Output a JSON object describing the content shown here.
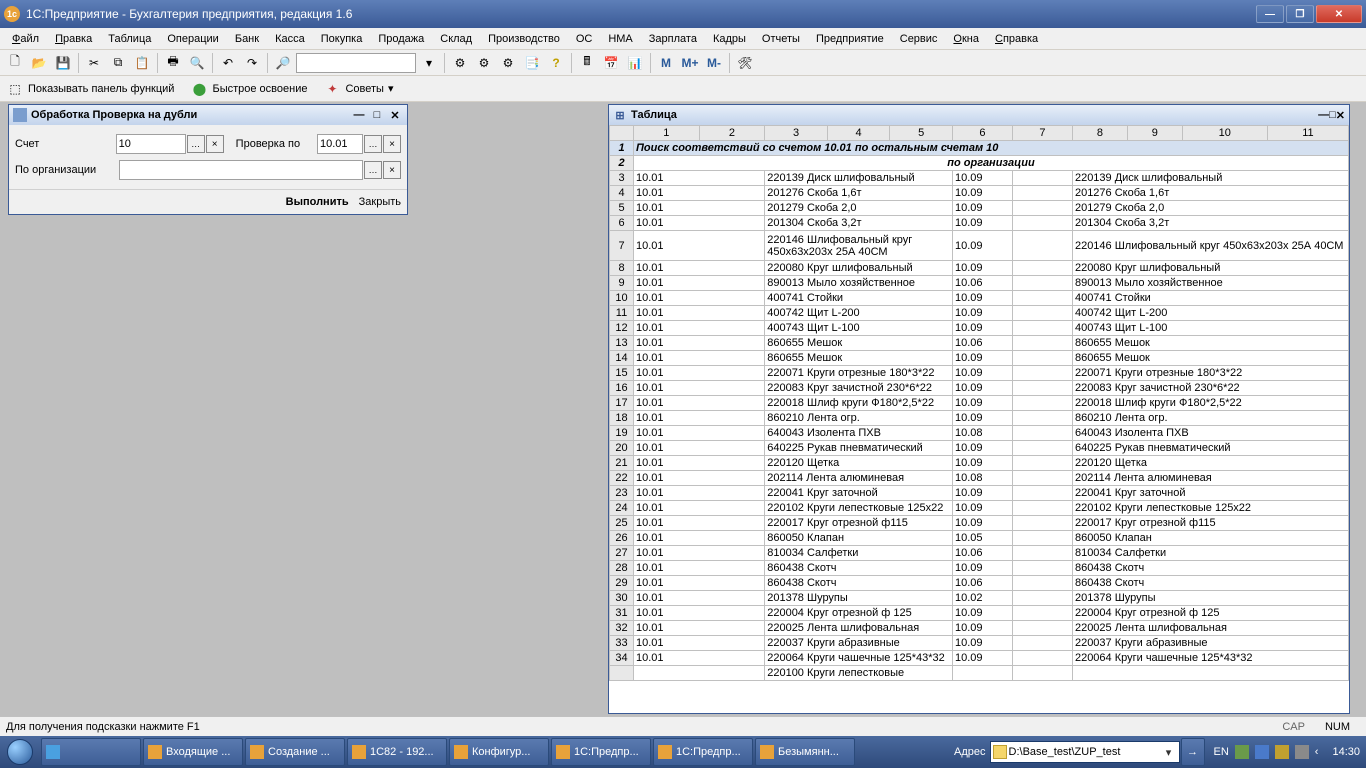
{
  "titlebar": {
    "text": "1С:Предприятие - Бухгалтерия предприятия, редакция 1.6"
  },
  "menu": [
    "Файл",
    "Правка",
    "Таблица",
    "Операции",
    "Банк",
    "Касса",
    "Покупка",
    "Продажа",
    "Склад",
    "Производство",
    "ОС",
    "НМА",
    "Зарплата",
    "Кадры",
    "Отчеты",
    "Предприятие",
    "Сервис",
    "Окна",
    "Справка"
  ],
  "menu_keys": [
    "Ф",
    "П",
    "",
    "",
    "",
    "",
    "",
    "",
    "",
    "",
    "",
    "",
    "",
    "",
    "",
    "",
    "",
    "О",
    "С"
  ],
  "toolbar2": {
    "m": "М",
    "mp": "М+",
    "mm": "М-"
  },
  "toolbar3": {
    "panel": "Показывать панель функций",
    "quick": "Быстрое освоение",
    "tips": "Советы"
  },
  "dlg": {
    "title": "Обработка  Проверка на дубли",
    "lbl_account": "Счет",
    "val_account": "10",
    "lbl_check": "Проверка по",
    "val_check": "10.01",
    "lbl_org": "По организации",
    "val_org": "",
    "run": "Выполнить",
    "close": "Закрыть"
  },
  "sheet": {
    "title": "Таблица",
    "cols": [
      "1",
      "2",
      "3",
      "4",
      "5",
      "6",
      "7",
      "8",
      "9",
      "10",
      "11"
    ],
    "row1": "Поиск соответствий со счетом 10.01 по остальным счетам 10",
    "row2": "по организации",
    "rows": [
      {
        "n": "3",
        "a": "10.01",
        "d1": "220139 Диск шлифовальный",
        "a2": "10.09",
        "d2": "220139 Диск шлифовальный"
      },
      {
        "n": "4",
        "a": "10.01",
        "d1": "201276 Скоба 1,6т",
        "a2": "10.09",
        "d2": "201276 Скоба 1,6т"
      },
      {
        "n": "5",
        "a": "10.01",
        "d1": "201279 Скоба 2,0",
        "a2": "10.09",
        "d2": "201279 Скоба 2,0"
      },
      {
        "n": "6",
        "a": "10.01",
        "d1": "201304 Скоба 3,2т",
        "a2": "10.09",
        "d2": "201304 Скоба 3,2т"
      },
      {
        "n": "7",
        "a": "10.01",
        "d1": "220146 Шлифовальный круг 450х63х203х 25А 40СМ",
        "a2": "10.09",
        "d2": "220146 Шлифовальный круг 450х63х203х 25А 40СМ"
      },
      {
        "n": "8",
        "a": "10.01",
        "d1": "220080 Круг шлифовальный",
        "a2": "10.09",
        "d2": "220080 Круг шлифовальный"
      },
      {
        "n": "9",
        "a": "10.01",
        "d1": "890013 Мыло хозяйственное",
        "a2": "10.06",
        "d2": "890013 Мыло хозяйственное"
      },
      {
        "n": "10",
        "a": "10.01",
        "d1": "400741 Стойки",
        "a2": "10.09",
        "d2": "400741 Стойки"
      },
      {
        "n": "11",
        "a": "10.01",
        "d1": "400742 Щит L-200",
        "a2": "10.09",
        "d2": "400742 Щит L-200"
      },
      {
        "n": "12",
        "a": "10.01",
        "d1": "400743 Щит L-100",
        "a2": "10.09",
        "d2": "400743 Щит L-100"
      },
      {
        "n": "13",
        "a": "10.01",
        "d1": "860655 Мешок",
        "a2": "10.06",
        "d2": "860655 Мешок"
      },
      {
        "n": "14",
        "a": "10.01",
        "d1": "860655 Мешок",
        "a2": "10.09",
        "d2": "860655 Мешок"
      },
      {
        "n": "15",
        "a": "10.01",
        "d1": "220071 Круги отрезные 180*3*22",
        "a2": "10.09",
        "d2": "220071 Круги отрезные 180*3*22"
      },
      {
        "n": "16",
        "a": "10.01",
        "d1": "220083 Круг зачистной 230*6*22",
        "a2": "10.09",
        "d2": "220083 Круг зачистной 230*6*22"
      },
      {
        "n": "17",
        "a": "10.01",
        "d1": "220018 Шлиф круги Ф180*2,5*22",
        "a2": "10.09",
        "d2": "220018 Шлиф круги Ф180*2,5*22"
      },
      {
        "n": "18",
        "a": "10.01",
        "d1": "860210 Лента огр.",
        "a2": "10.09",
        "d2": "860210 Лента огр."
      },
      {
        "n": "19",
        "a": "10.01",
        "d1": "640043 Изолента  ПХВ",
        "a2": "10.08",
        "d2": "640043 Изолента  ПХВ"
      },
      {
        "n": "20",
        "a": "10.01",
        "d1": "640225 Рукав пневматический",
        "a2": "10.09",
        "d2": "640225 Рукав пневматический"
      },
      {
        "n": "21",
        "a": "10.01",
        "d1": "220120 Щетка",
        "a2": "10.09",
        "d2": "220120 Щетка"
      },
      {
        "n": "22",
        "a": "10.01",
        "d1": "202114 Лента алюминевая",
        "a2": "10.08",
        "d2": "202114 Лента алюминевая"
      },
      {
        "n": "23",
        "a": "10.01",
        "d1": "220041 Круг заточной",
        "a2": "10.09",
        "d2": "220041 Круг заточной"
      },
      {
        "n": "24",
        "a": "10.01",
        "d1": "220102 Круги лепестковые 125х22",
        "a2": "10.09",
        "d2": "220102 Круги лепестковые 125х22"
      },
      {
        "n": "25",
        "a": "10.01",
        "d1": "220017 Круг отрезной ф115",
        "a2": "10.09",
        "d2": "220017 Круг отрезной ф115"
      },
      {
        "n": "26",
        "a": "10.01",
        "d1": "860050 Клапан",
        "a2": "10.05",
        "d2": "860050 Клапан"
      },
      {
        "n": "27",
        "a": "10.01",
        "d1": "810034 Салфетки",
        "a2": "10.06",
        "d2": "810034 Салфетки"
      },
      {
        "n": "28",
        "a": "10.01",
        "d1": "860438 Скотч",
        "a2": "10.09",
        "d2": "860438 Скотч"
      },
      {
        "n": "29",
        "a": "10.01",
        "d1": "860438 Скотч",
        "a2": "10.06",
        "d2": "860438 Скотч"
      },
      {
        "n": "30",
        "a": "10.01",
        "d1": "201378 Шурупы",
        "a2": "10.02",
        "d2": "201378 Шурупы"
      },
      {
        "n": "31",
        "a": "10.01",
        "d1": "220004 Круг отрезной ф 125",
        "a2": "10.09",
        "d2": "220004 Круг отрезной ф 125"
      },
      {
        "n": "32",
        "a": "10.01",
        "d1": "220025 Лента шлифовальная",
        "a2": "10.09",
        "d2": "220025 Лента шлифовальная"
      },
      {
        "n": "33",
        "a": "10.01",
        "d1": "220037 Круги абразивные",
        "a2": "10.09",
        "d2": "220037 Круги абразивные"
      },
      {
        "n": "34",
        "a": "10.01",
        "d1": "220064 Круги чашечные 125*43*32",
        "a2": "10.09",
        "d2": "220064 Круги чашечные 125*43*32"
      },
      {
        "n": "",
        "a": "",
        "d1": "220100 Круги лепестковые",
        "a2": "",
        "d2": ""
      }
    ]
  },
  "mdibar": {
    "tab1": "Обработка  Проверка на ду...",
    "tab2": "Таблица"
  },
  "status": {
    "hint": "Для получения подсказки нажмите F1",
    "cap": "CAP",
    "num": "NUM"
  },
  "taskbar": {
    "items": [
      "Входящие ...",
      "Создание ...",
      "1С82 - 192...",
      "Конфигур...",
      "1С:Предпр...",
      "1С:Предпр...",
      "Безымянн..."
    ],
    "addr_lbl": "Адрес",
    "addr_val": "D:\\Base_test\\ZUP_test",
    "lang": "EN",
    "clock": "14:30"
  }
}
